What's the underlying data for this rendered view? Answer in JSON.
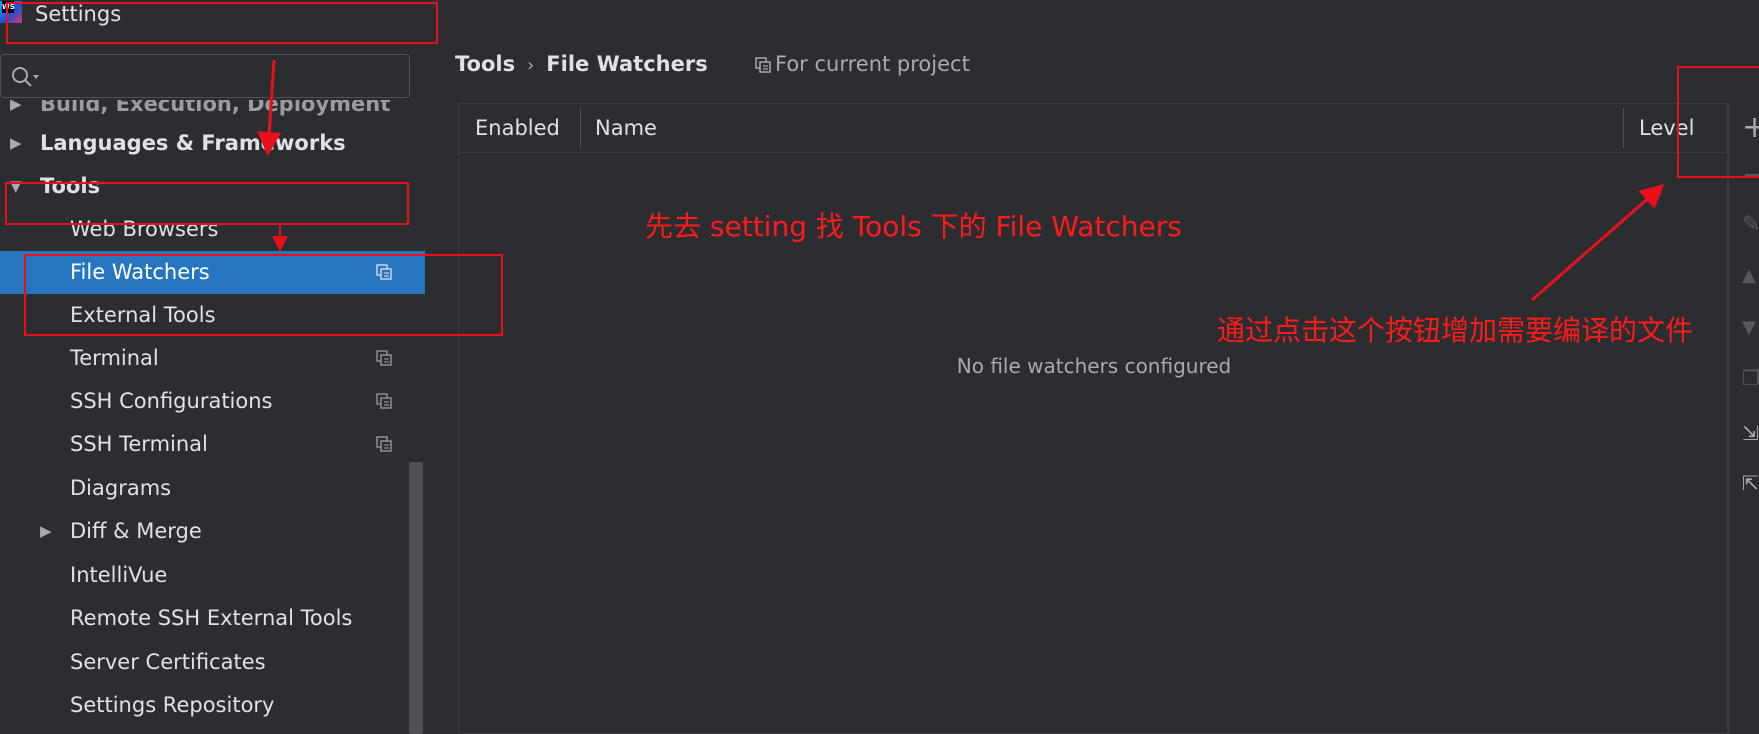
{
  "window": {
    "title": "Settings",
    "app_icon_text": "WS"
  },
  "search": {
    "placeholder": "",
    "value": ""
  },
  "sidebar": {
    "items": [
      {
        "label": "Build, Execution, Deployment",
        "bold": true,
        "expandable": true,
        "expanded": false
      },
      {
        "label": "Languages & Frameworks",
        "bold": true,
        "expandable": true,
        "expanded": false
      },
      {
        "label": "Tools",
        "bold": true,
        "expandable": true,
        "expanded": true
      },
      {
        "label": "Web Browsers"
      },
      {
        "label": "File Watchers",
        "selected": true,
        "project_icon": true
      },
      {
        "label": "External Tools"
      },
      {
        "label": "Terminal",
        "project_icon": true
      },
      {
        "label": "SSH Configurations",
        "project_icon": true
      },
      {
        "label": "SSH Terminal",
        "project_icon": true
      },
      {
        "label": "Diagrams"
      },
      {
        "label": "Diff & Merge",
        "expandable": true,
        "expanded": false
      },
      {
        "label": "IntelliVue"
      },
      {
        "label": "Remote SSH External Tools"
      },
      {
        "label": "Server Certificates"
      },
      {
        "label": "Settings Repository"
      }
    ]
  },
  "breadcrumb": {
    "parent": "Tools",
    "separator": "›",
    "current": "File Watchers"
  },
  "scope_label": "For current project",
  "table": {
    "columns": [
      "Enabled",
      "Name",
      "Level"
    ],
    "empty_text": "No file watchers configured"
  },
  "toolbar": {
    "icons": [
      "add-icon",
      "remove-icon",
      "edit-icon",
      "move-up-icon",
      "move-down-icon",
      "copy-icon",
      "import-icon",
      "export-icon"
    ]
  },
  "annotations": {
    "note1": "先去 setting 找 Tools 下的 File Watchers",
    "note2": "通过点击这个按钮增加需要编译的文件"
  },
  "colors": {
    "background": "#2b2d30",
    "selection": "#2675bf",
    "annotation_red": "#ff1a1a"
  }
}
